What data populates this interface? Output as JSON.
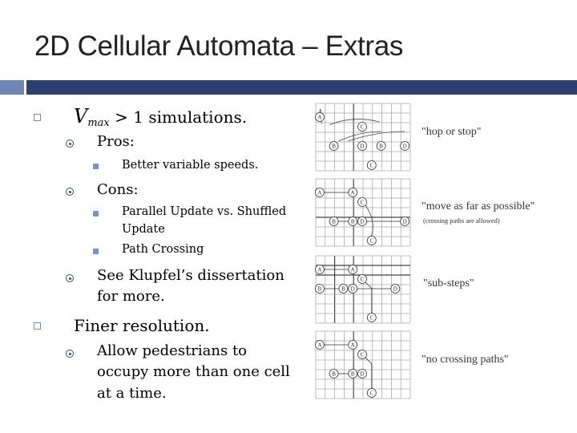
{
  "slide": {
    "title": "2D Cellular Automata – Extras",
    "accent_colors": {
      "bar_light": "#6d86b5",
      "bar_dark": "#2c4170"
    }
  },
  "bullets": {
    "vmax": {
      "symbol": "V",
      "subscript": "max",
      "text": " > 1 simulations.",
      "pros": {
        "label": "Pros:",
        "items": [
          "Better variable speeds."
        ]
      },
      "cons": {
        "label": "Cons:",
        "items": [
          "Parallel Update vs. Shuffled",
          "Update",
          "Path Crossing"
        ]
      },
      "see": {
        "line1": "See Klupfel’s dissertation",
        "line2": "for more."
      }
    },
    "finer": {
      "label": "Finer resolution.",
      "detail": {
        "line1": "Allow pedestrians to",
        "line2": "occupy more than one cell",
        "line3": "at a time."
      }
    }
  },
  "figures": [
    {
      "caption": "\"hop or stop\"",
      "subcaption": ""
    },
    {
      "caption": "\"move as far as possible\"",
      "subcaption": "(crossing paths are allowed)"
    },
    {
      "caption": "\"sub-steps\"",
      "subcaption": ""
    },
    {
      "caption": "\"no crossing paths\"",
      "subcaption": ""
    }
  ],
  "node_labels": {
    "a": "A",
    "b": "B",
    "c": "C",
    "d": "D"
  }
}
